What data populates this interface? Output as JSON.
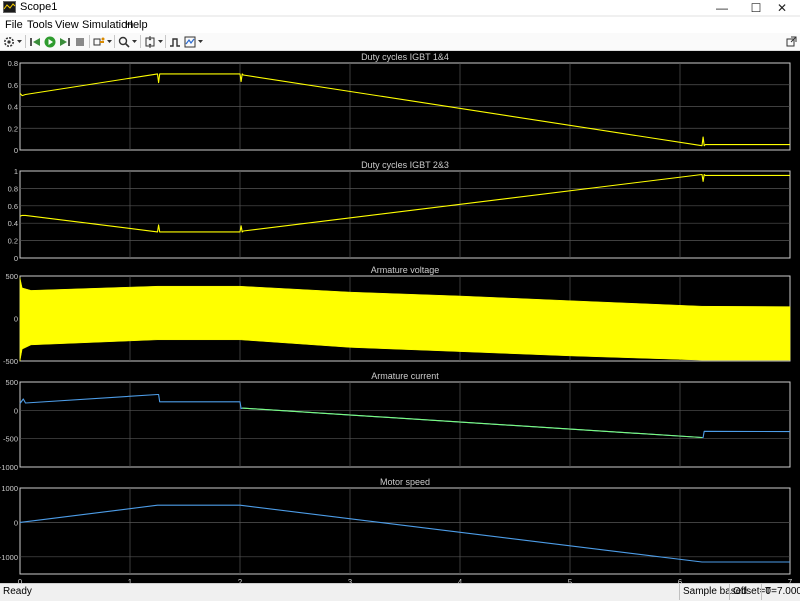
{
  "window": {
    "title": "Scope1",
    "controls": {
      "minimize": "—",
      "maximize": "☐",
      "close": "✕"
    }
  },
  "menu": [
    "File",
    "Tools",
    "View",
    "Simulation",
    "Help"
  ],
  "toolbar": {
    "icons": [
      "settings-icon",
      "dropdown-icon",
      "step-back-icon",
      "run-icon",
      "step-forward-icon",
      "stop-icon",
      "highlight-icon",
      "dropdown-icon",
      "zoom-icon",
      "dropdown-icon",
      "fit-icon",
      "dropdown-icon",
      "triggers-icon",
      "measurements-icon",
      "dropdown-icon"
    ],
    "undock_icon": "undock-icon"
  },
  "colors": {
    "plot_bg": "#000000",
    "axes_fg": "#cccccc",
    "grid": "#555555",
    "yellow": "#ffff00",
    "cyan_blue": "#4d9de8"
  },
  "chart_data": [
    {
      "type": "line",
      "title": "Duty cycles IGBT 1&4",
      "xlim": [
        0,
        7
      ],
      "ylim": [
        0,
        0.8
      ],
      "yticks": [
        "0",
        "0.2",
        "0.4",
        "0.6",
        "0.8"
      ],
      "grid": true,
      "series": [
        {
          "color": "#ffff00",
          "x": [
            0,
            0.02,
            0.05,
            1.25,
            1.26,
            1.27,
            1.28,
            2.0,
            2.01,
            2.02,
            2.03,
            6.2,
            6.21,
            6.22,
            6.23,
            7.0
          ],
          "y": [
            0.52,
            0.5,
            0.51,
            0.7,
            0.62,
            0.7,
            0.7,
            0.7,
            0.63,
            0.7,
            0.69,
            0.04,
            0.12,
            0.04,
            0.05,
            0.05
          ]
        }
      ]
    },
    {
      "type": "line",
      "title": "Duty cycles IGBT 2&3",
      "xlim": [
        0,
        7
      ],
      "ylim": [
        0,
        1
      ],
      "yticks": [
        "0",
        "0.2",
        "0.4",
        "0.6",
        "0.8",
        "1"
      ],
      "grid": true,
      "series": [
        {
          "color": "#ffff00",
          "x": [
            0,
            0.02,
            0.05,
            1.25,
            1.26,
            1.27,
            1.28,
            2.0,
            2.01,
            2.02,
            2.03,
            6.2,
            6.21,
            6.22,
            6.23,
            7.0
          ],
          "y": [
            0.48,
            0.49,
            0.49,
            0.3,
            0.38,
            0.3,
            0.3,
            0.3,
            0.37,
            0.3,
            0.31,
            0.96,
            0.88,
            0.96,
            0.95,
            0.95
          ]
        }
      ]
    },
    {
      "type": "area",
      "title": "Armature voltage",
      "xlim": [
        0,
        7
      ],
      "ylim": [
        -500,
        500
      ],
      "yticks": [
        "-500",
        "0",
        "500"
      ],
      "grid": true,
      "series": [
        {
          "color": "#ffff00",
          "x": [
            0,
            0.02,
            0.1,
            1.25,
            2.0,
            3.0,
            4.0,
            5.0,
            6.2,
            7.0
          ],
          "upper": [
            480,
            360,
            330,
            380,
            380,
            310,
            265,
            210,
            145,
            140
          ],
          "lower": [
            -500,
            -360,
            -310,
            -250,
            -250,
            -340,
            -390,
            -440,
            -490,
            -490
          ]
        }
      ]
    },
    {
      "type": "line",
      "title": "Armature current",
      "xlim": [
        0,
        7
      ],
      "ylim": [
        -1000,
        500
      ],
      "yticks": [
        "-1000",
        "-500",
        "0",
        "500"
      ],
      "grid": true,
      "series": [
        {
          "color": "#4d9de8",
          "x": [
            0,
            0.03,
            0.05,
            1.25,
            1.26,
            1.27,
            2.0,
            2.01,
            2.02,
            6.2,
            6.21,
            6.22,
            7.0
          ],
          "y": [
            120,
            200,
            130,
            280,
            280,
            150,
            150,
            30,
            40,
            -480,
            -480,
            -370,
            -375
          ]
        },
        {
          "color": "#7cfc7c",
          "x": [
            2.02,
            6.2
          ],
          "y": [
            40,
            -480
          ]
        }
      ]
    },
    {
      "type": "line",
      "title": "Motor speed",
      "xlim": [
        0,
        7
      ],
      "ylim": [
        -1500,
        1000
      ],
      "yticks": [
        "-1000",
        "0",
        "1000"
      ],
      "xticks": [
        "0",
        "1",
        "2",
        "3",
        "4",
        "5",
        "6",
        "7"
      ],
      "grid": true,
      "series": [
        {
          "color": "#4d9de8",
          "x": [
            0,
            1.25,
            2.0,
            6.2,
            7.0
          ],
          "y": [
            0,
            500,
            500,
            -1150,
            -1150
          ]
        }
      ]
    }
  ],
  "status": {
    "ready": "Ready",
    "sample_based": "Sample based",
    "offset": "Offset=0",
    "time": "T=7.000"
  }
}
